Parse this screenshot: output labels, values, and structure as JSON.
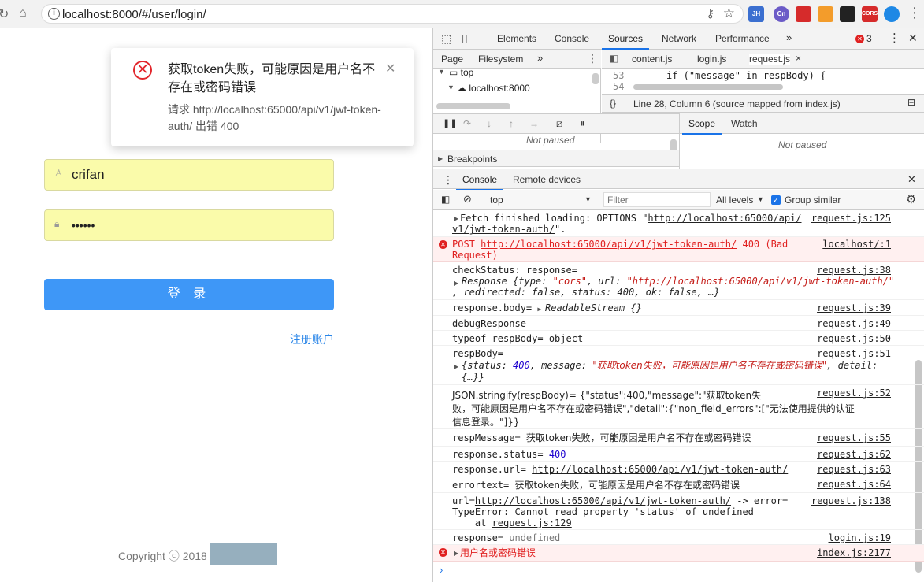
{
  "browser": {
    "url": "localhost:8000/#/user/login/",
    "extensions": [
      "JH",
      "Cn",
      "CORS"
    ]
  },
  "login": {
    "notification": {
      "title": "获取token失败，可能原因是用户名不存在或密码错误",
      "description": "请求 http://localhost:65000/api/v1/jwt-token-auth/ 出错 400"
    },
    "username": "crifan",
    "password": "••••••",
    "login_button": "登 录",
    "register_link": "注册账户",
    "copyright": "Copyright ⓒ 2018"
  },
  "devtools": {
    "tabs": [
      "Elements",
      "Console",
      "Sources",
      "Network",
      "Performance"
    ],
    "active_tab": "Sources",
    "error_count": "3",
    "navigator": {
      "tabs": [
        "Page",
        "Filesystem"
      ],
      "tree": [
        "top",
        "localhost:8000"
      ]
    },
    "editor": {
      "files": [
        "content.js",
        "login.js",
        "request.js"
      ],
      "active_file": "request.js",
      "lines": [
        {
          "num": "53",
          "code": "if (\"message\" in respBody) {"
        },
        {
          "num": "54",
          "code": ""
        }
      ],
      "status": "Line 28, Column 6  (source mapped from index.js)"
    },
    "debugger": {
      "not_paused": "Not paused",
      "breakpoints": "Breakpoints",
      "scope_tabs": [
        "Scope",
        "Watch"
      ],
      "scope_not_paused": "Not paused"
    },
    "drawer": {
      "tabs": [
        "Console",
        "Remote devices"
      ],
      "context": "top",
      "filter_placeholder": "Filter",
      "levels": "All levels",
      "group_similar": "Group similar"
    },
    "console": {
      "m1_a": "Fetch finished loading: OPTIONS \"",
      "m1_url1": "http://localhost:65000/api/",
      "m1_url2": "v1/jwt-token-auth/",
      "m1_end": "\".",
      "m1_src": "request.js:125",
      "m2_post": "POST",
      "m2_url": "http://localhost:65000/api/v1/jwt-token-auth/",
      "m2_status": "400 (Bad",
      "m2_status2": "Request)",
      "m2_src": "localhost/:1",
      "m3_a": "checkStatus: response=",
      "m3_obj_label": "Response",
      "m3_type_key": "type",
      "m3_type_val": "\"cors\"",
      "m3_url_key": "url",
      "m3_url_val": "\"http://localhost:65000/api/v1/jwt-token-auth/\"",
      "m3_line2": ", redirected: false, status: 400, ok: false, …}",
      "m3_src": "request.js:38",
      "m4": "response.body= ",
      "m4_obj": "ReadableStream {}",
      "m4_src": "request.js:39",
      "m5": "debugResponse",
      "m5_src": "request.js:49",
      "m6": "typeof respBody= object",
      "m6_src": "request.js:50",
      "m7": "respBody=",
      "m7_status": "400",
      "m7_msg": "\"获取token失败，可能原因是用户名不存在或密码错误\"",
      "m7_end": "{…}}",
      "m7_src": "request.js:51",
      "m8_l1": "JSON.stringify(respBody)= {\"status\":400,\"message\":\"获取token失",
      "m8_l2": "败，可能原因是用户名不存在或密码错误\",\"detail\":{\"non_field_errors\":[\"无法使用提供的认证",
      "m8_l3": "信息登录。\"]}}",
      "m8_src": "request.js:52",
      "m9_a": "respMessage= ",
      "m9_b": "获取token失败，可能原因是用户名不存在或密码错误",
      "m9_src": "request.js:55",
      "m10_a": "response.status= ",
      "m10_b": "400",
      "m10_src": "request.js:62",
      "m11_a": "response.url= ",
      "m11_b": "http://localhost:65000/api/v1/jwt-token-auth/",
      "m11_src": "request.js:63",
      "m12_a": "errortext= ",
      "m12_b": "获取token失败，可能原因是用户名不存在或密码错误",
      "m12_src": "request.js:64",
      "m13_a": "url=",
      "m13_url": "http://localhost:65000/api/v1/jwt-token-auth/",
      "m13_b": " -> error=",
      "m13_l2": "TypeError: Cannot read property 'status' of undefined",
      "m13_l3_a": "    at ",
      "m13_l3_b": "request.js:129",
      "m13_src": "request.js:138",
      "m14_a": "response= ",
      "m14_b": "undefined",
      "m14_src": "login.js:19",
      "m15": "用户名或密码错误",
      "m15_src": "index.js:2177"
    }
  }
}
